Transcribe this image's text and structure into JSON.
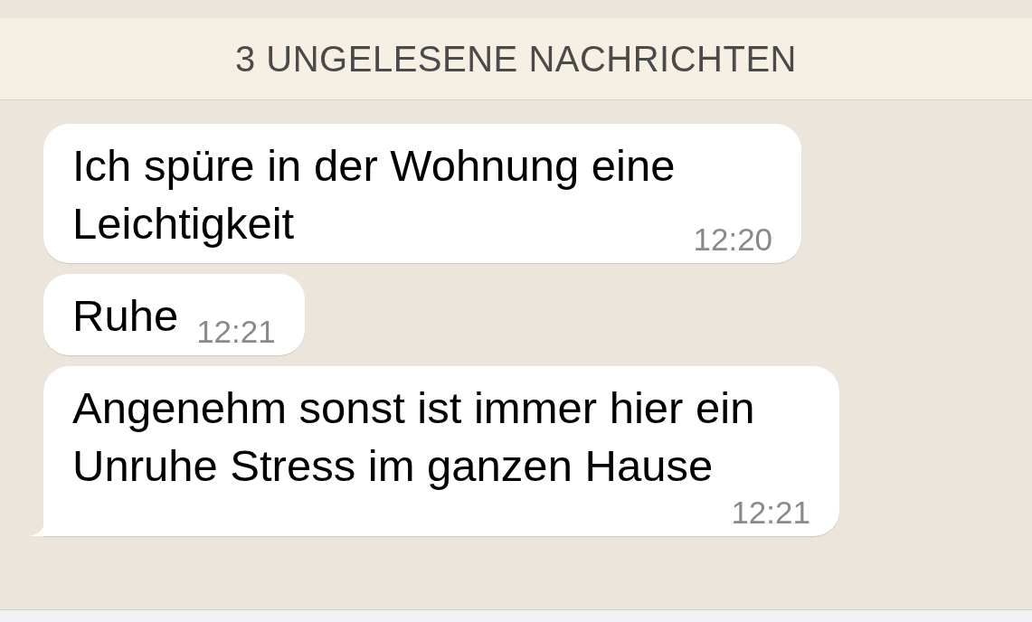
{
  "unread_banner": {
    "label": "3 UNGELESENE NACHRICHTEN"
  },
  "messages": [
    {
      "text": "Ich spüre in der Wohnung eine\nLeichtigkeit",
      "time": "12:20",
      "tail": false
    },
    {
      "text": "Ruhe",
      "time": "12:21",
      "tail": false
    },
    {
      "text": "Angenehm sonst ist immer hier ein\nUnruhe Stress im ganzen Hause",
      "time": "12:21",
      "tail": true
    }
  ]
}
